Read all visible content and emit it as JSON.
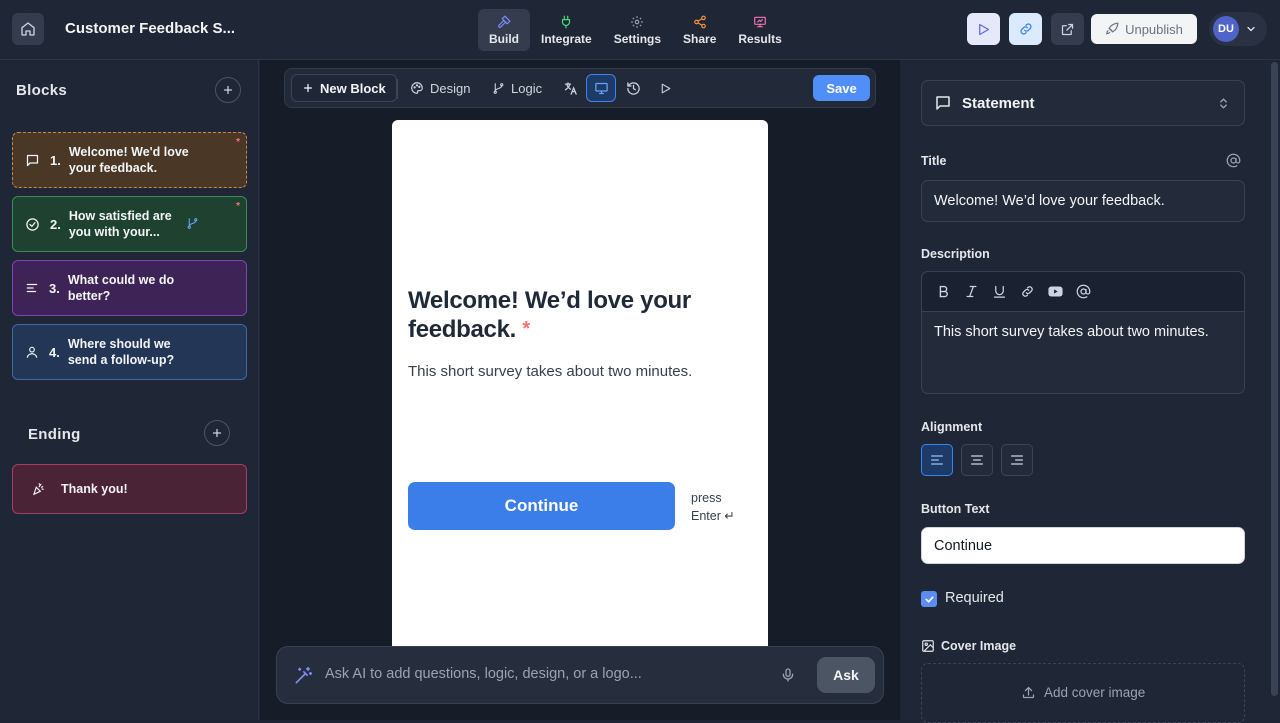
{
  "app": {
    "title": "Customer Feedback S..."
  },
  "nav": {
    "tabs": [
      {
        "label": "Build",
        "icon": "hammer-icon",
        "active": true
      },
      {
        "label": "Integrate",
        "icon": "plug-icon"
      },
      {
        "label": "Settings",
        "icon": "gear-icon"
      },
      {
        "label": "Share",
        "icon": "share-icon"
      },
      {
        "label": "Results",
        "icon": "presentation-icon"
      }
    ]
  },
  "header_actions": {
    "unpublish_label": "Unpublish",
    "avatar_initials": "DU"
  },
  "blocks_panel": {
    "heading": "Blocks",
    "items": [
      {
        "num": "1.",
        "text": "Welcome! We'd love your feedback.",
        "icon": "message-square-icon",
        "required": true
      },
      {
        "num": "2.",
        "text": "How satisfied are you with your...",
        "icon": "check-circle-icon",
        "required": true,
        "has_logic": true
      },
      {
        "num": "3.",
        "text": "What could we do better?",
        "icon": "text-lines-icon"
      },
      {
        "num": "4.",
        "text": "Where should we send a follow-up?",
        "icon": "user-icon"
      }
    ],
    "ending_heading": "Ending",
    "ending_item": {
      "text": "Thank you!",
      "icon": "party-popper-icon"
    },
    "required_marker": "*"
  },
  "toolbar": {
    "new_block_label": "New Block",
    "design_label": "Design",
    "logic_label": "Logic",
    "save_label": "Save"
  },
  "preview": {
    "title": "Welcome! We’d love your feedback.",
    "required_marker": "*",
    "description": "This short survey takes about two minutes.",
    "button_label": "Continue",
    "press_hint_line1": "press",
    "press_hint_line2": "Enter ↵"
  },
  "ai_bar": {
    "placeholder": "Ask AI to add questions, logic, design, or a logo...",
    "ask_label": "Ask"
  },
  "properties": {
    "block_type": "Statement",
    "title_label": "Title",
    "title_value": "Welcome! We’d love your feedback.",
    "description_label": "Description",
    "description_value": "This short survey takes about two minutes.",
    "alignment_label": "Alignment",
    "alignment_selected": "left",
    "button_text_label": "Button Text",
    "button_text_value": "Continue",
    "required_label": "Required",
    "required_checked": true,
    "cover_image_label": "Cover Image",
    "add_cover_label": "Add cover image"
  },
  "colors": {
    "accent": "#3b82f6",
    "continue_button": "#3b7de9",
    "save_button": "#4f8ff7",
    "required_star": "#f87171"
  }
}
